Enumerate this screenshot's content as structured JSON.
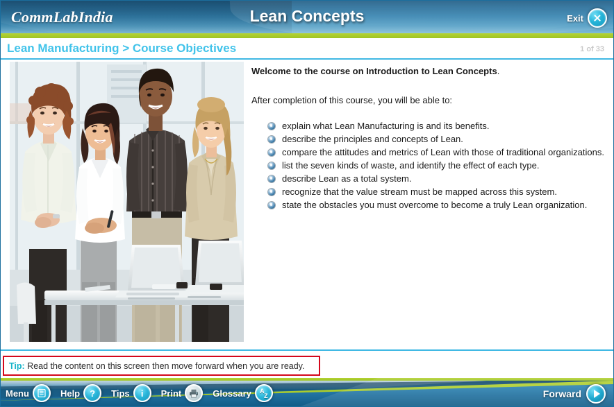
{
  "header": {
    "logo": "CommLabIndia",
    "course_title": "Lean Concepts",
    "exit_label": "Exit",
    "exit_icon": "close-x-icon",
    "accent_blue": "#2a7cab",
    "accent_green": "#b5d334",
    "accent_cyan": "#3fb8e4"
  },
  "breadcrumb": {
    "text": "Lean Manufacturing > Course Objectives",
    "color": "#41c3ea",
    "page_count": "1 of 33"
  },
  "main": {
    "image_alt": "four business professionals standing and smiling beside a desk with two open laptops",
    "lead_bold": "Welcome to the course on Introduction to Lean Concepts",
    "lead_tail": ".",
    "sub": "After completion of this course, you will be able to:",
    "objectives": [
      "explain what Lean Manufacturing is and its benefits.",
      "describe the principles and concepts of Lean.",
      "compare the attitudes and metrics of Lean with those of traditional organizations.",
      "list the seven kinds of waste, and identify the effect of each type.",
      "describe Lean as a total system.",
      "recognize that the value stream must be mapped across this system.",
      "state the obstacles you must overcome to become a truly Lean organization."
    ]
  },
  "tip": {
    "label": "Tip:",
    "text": "Read the content on this screen then move forward when you are ready.",
    "label_color": "#17b3c9",
    "border_color": "#d4071b"
  },
  "footer": {
    "nav": [
      {
        "label": "Menu",
        "icon": "list-menu-icon"
      },
      {
        "label": "Help",
        "icon": "question-mark-icon"
      },
      {
        "label": "Tips",
        "icon": "info-icon"
      },
      {
        "label": "Print",
        "icon": "printer-icon"
      },
      {
        "label": "Glossary",
        "icon": "a-to-z-icon"
      }
    ],
    "forward_label": "Forward",
    "forward_icon": "play-triangle-icon"
  }
}
